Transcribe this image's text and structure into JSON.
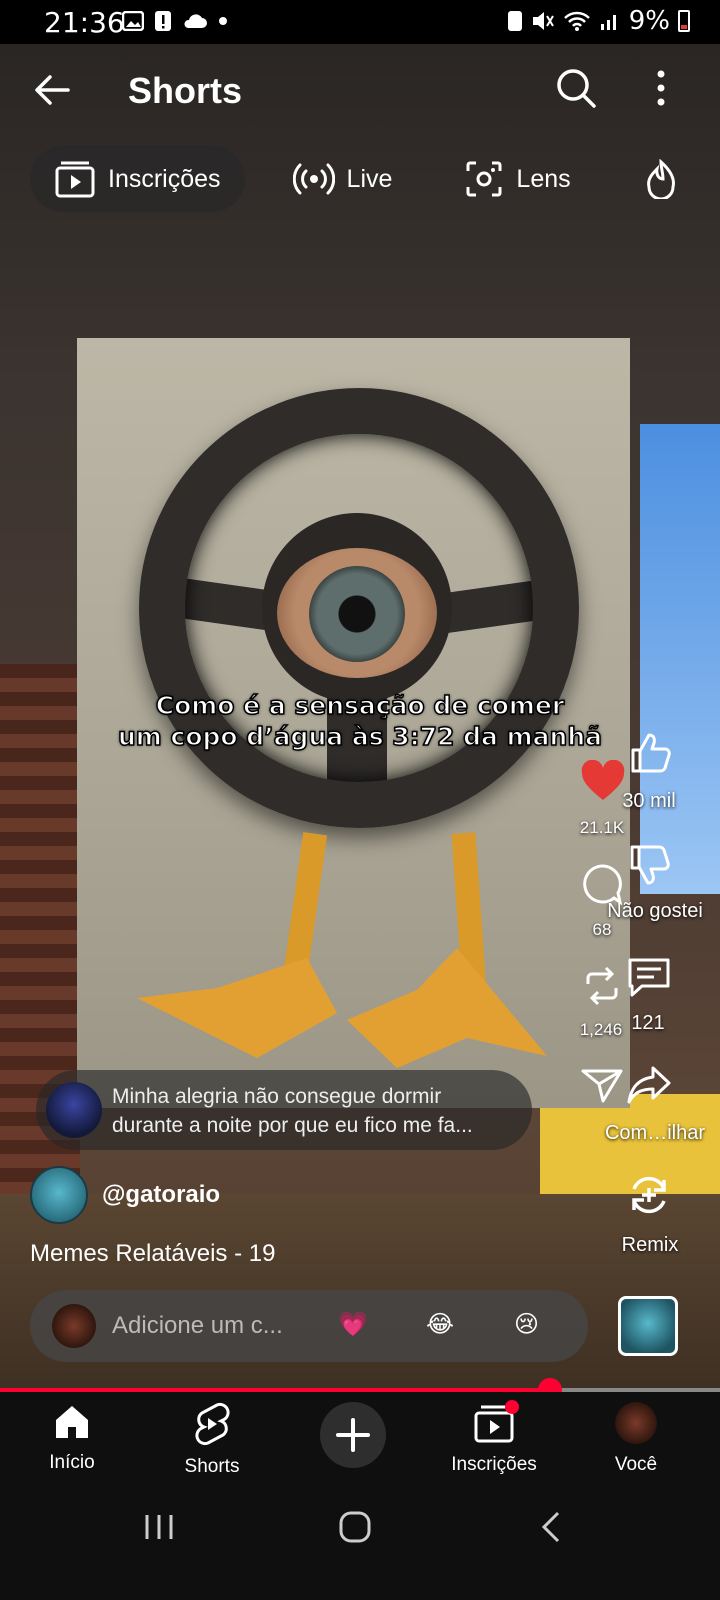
{
  "status_bar": {
    "time": "21:36",
    "battery": "9%"
  },
  "header": {
    "title": "Shorts"
  },
  "chips": [
    {
      "label": "Inscrições",
      "icon": "subscriptions-icon"
    },
    {
      "label": "Live",
      "icon": "live-icon"
    },
    {
      "label": "Lens",
      "icon": "lens-icon"
    }
  ],
  "video": {
    "caption_line1": "Como é a sensação de comer",
    "caption_line2": "um copo d’água às 3:72 da manhã",
    "title": "Memes Relatáveis - 19",
    "channel": "@gatoraio",
    "progress": 0.764
  },
  "rail": {
    "like_count": "30 mil",
    "heart_count": "21.1K",
    "dislike_label": "Não gostei",
    "comments_small": "68",
    "comments_count": "121",
    "remix_small": "1,246",
    "share_label": "Com…ilhar",
    "remix_label": "Remix"
  },
  "comment_teaser": {
    "line1": "Minha alegria não consegue dormir",
    "line2": "durante a noite por que eu fico me fa..."
  },
  "comment_box": {
    "placeholder": "Adicione um c...",
    "emoji": [
      "💗",
      "😂",
      "😢"
    ]
  },
  "bottom_nav": [
    {
      "label": "Início",
      "icon": "home-icon"
    },
    {
      "label": "Shorts",
      "icon": "shorts-icon"
    },
    {
      "label": "",
      "icon": "plus-icon"
    },
    {
      "label": "Inscrições",
      "icon": "subscriptions-icon"
    },
    {
      "label": "Você",
      "icon": "avatar"
    }
  ],
  "colors": {
    "accent": "#ff0033",
    "heart": "#e53935"
  }
}
